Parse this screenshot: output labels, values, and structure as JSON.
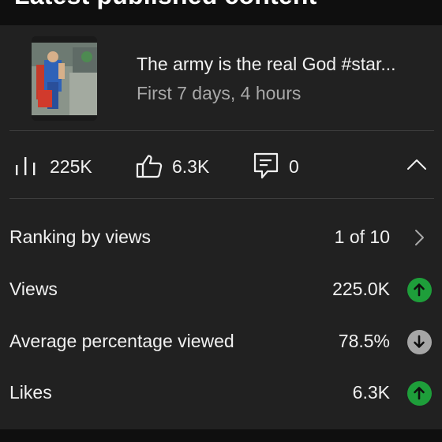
{
  "section": {
    "title": "Latest published content"
  },
  "video": {
    "title": "The army is the real God #star...",
    "subtitle": "First 7 days, 4 hours",
    "thumbnail_icon": "video-thumbnail"
  },
  "stats": {
    "views": {
      "icon": "bar-chart-icon",
      "value": "225K"
    },
    "likes": {
      "icon": "thumbs-up-icon",
      "value": "6.3K"
    },
    "comments": {
      "icon": "comment-icon",
      "value": "0"
    },
    "collapse_icon": "chevron-up-icon"
  },
  "metrics": [
    {
      "label": "Ranking by views",
      "value": "1 of 10",
      "trail": "chevron-right-icon"
    },
    {
      "label": "Views",
      "value": "225.0K",
      "trail": "trend-up-icon",
      "trend": "up"
    },
    {
      "label": "Average percentage viewed",
      "value": "78.5%",
      "trail": "trend-down-icon",
      "trend": "down"
    },
    {
      "label": "Likes",
      "value": "6.3K",
      "trail": "trend-up-icon",
      "trend": "up"
    }
  ],
  "colors": {
    "background": "#0f0f0f",
    "card": "#212121",
    "trend_up": "#1e9e3a",
    "trend_down": "#a6a6a6",
    "text_primary": "#f1f1f1",
    "text_secondary": "#a8a8a8"
  }
}
